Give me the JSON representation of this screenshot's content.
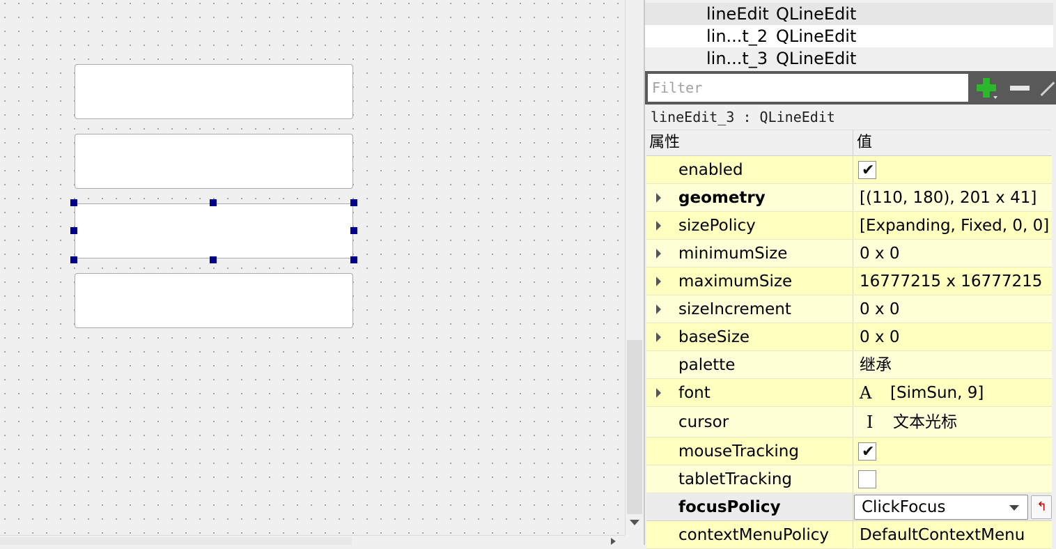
{
  "object_inspector": {
    "rows": [
      {
        "name": "lineEdit",
        "class": "QLineEdit"
      },
      {
        "name": "lin...t_2",
        "class": "QLineEdit"
      },
      {
        "name": "lin...t_3",
        "class": "QLineEdit"
      }
    ]
  },
  "property_editor": {
    "filter_placeholder": "Filter",
    "selected_object": "lineEdit_3 : QLineEdit",
    "header": {
      "property": "属性",
      "value": "值"
    },
    "properties": [
      {
        "name": "enabled",
        "type": "checkbox",
        "checked": true
      },
      {
        "name": "geometry",
        "value": "[(110, 180), 201 x 41]",
        "expandable": true,
        "bold": true
      },
      {
        "name": "sizePolicy",
        "value": "[Expanding, Fixed, 0, 0]",
        "expandable": true
      },
      {
        "name": "minimumSize",
        "value": "0 x 0",
        "expandable": true
      },
      {
        "name": "maximumSize",
        "value": "16777215 x 16777215",
        "expandable": true
      },
      {
        "name": "sizeIncrement",
        "value": "0 x 0",
        "expandable": true
      },
      {
        "name": "baseSize",
        "value": "0 x 0",
        "expandable": true
      },
      {
        "name": "palette",
        "value": "继承"
      },
      {
        "name": "font",
        "value": "[SimSun, 9]",
        "icon": "font-icon",
        "icon_glyph": "A",
        "expandable": true
      },
      {
        "name": "cursor",
        "value": "文本光标",
        "icon": "ibeam-cursor-icon",
        "icon_glyph": "I"
      },
      {
        "name": "mouseTracking",
        "type": "checkbox",
        "checked": true
      },
      {
        "name": "tabletTracking",
        "type": "checkbox",
        "checked": false
      },
      {
        "name": "focusPolicy",
        "type": "combo",
        "value": "ClickFocus",
        "bold": true
      },
      {
        "name": "contextMenuPolicy",
        "value": "DefaultContextMenu"
      }
    ]
  },
  "icons": {
    "add": "plus-icon",
    "remove": "minus-icon",
    "configure": "wrench-icon",
    "reset": "reset-arrow-icon"
  },
  "colors": {
    "handle": "#00008b",
    "property_row": "#ffffc0",
    "add_icon": "#2cb82c"
  }
}
